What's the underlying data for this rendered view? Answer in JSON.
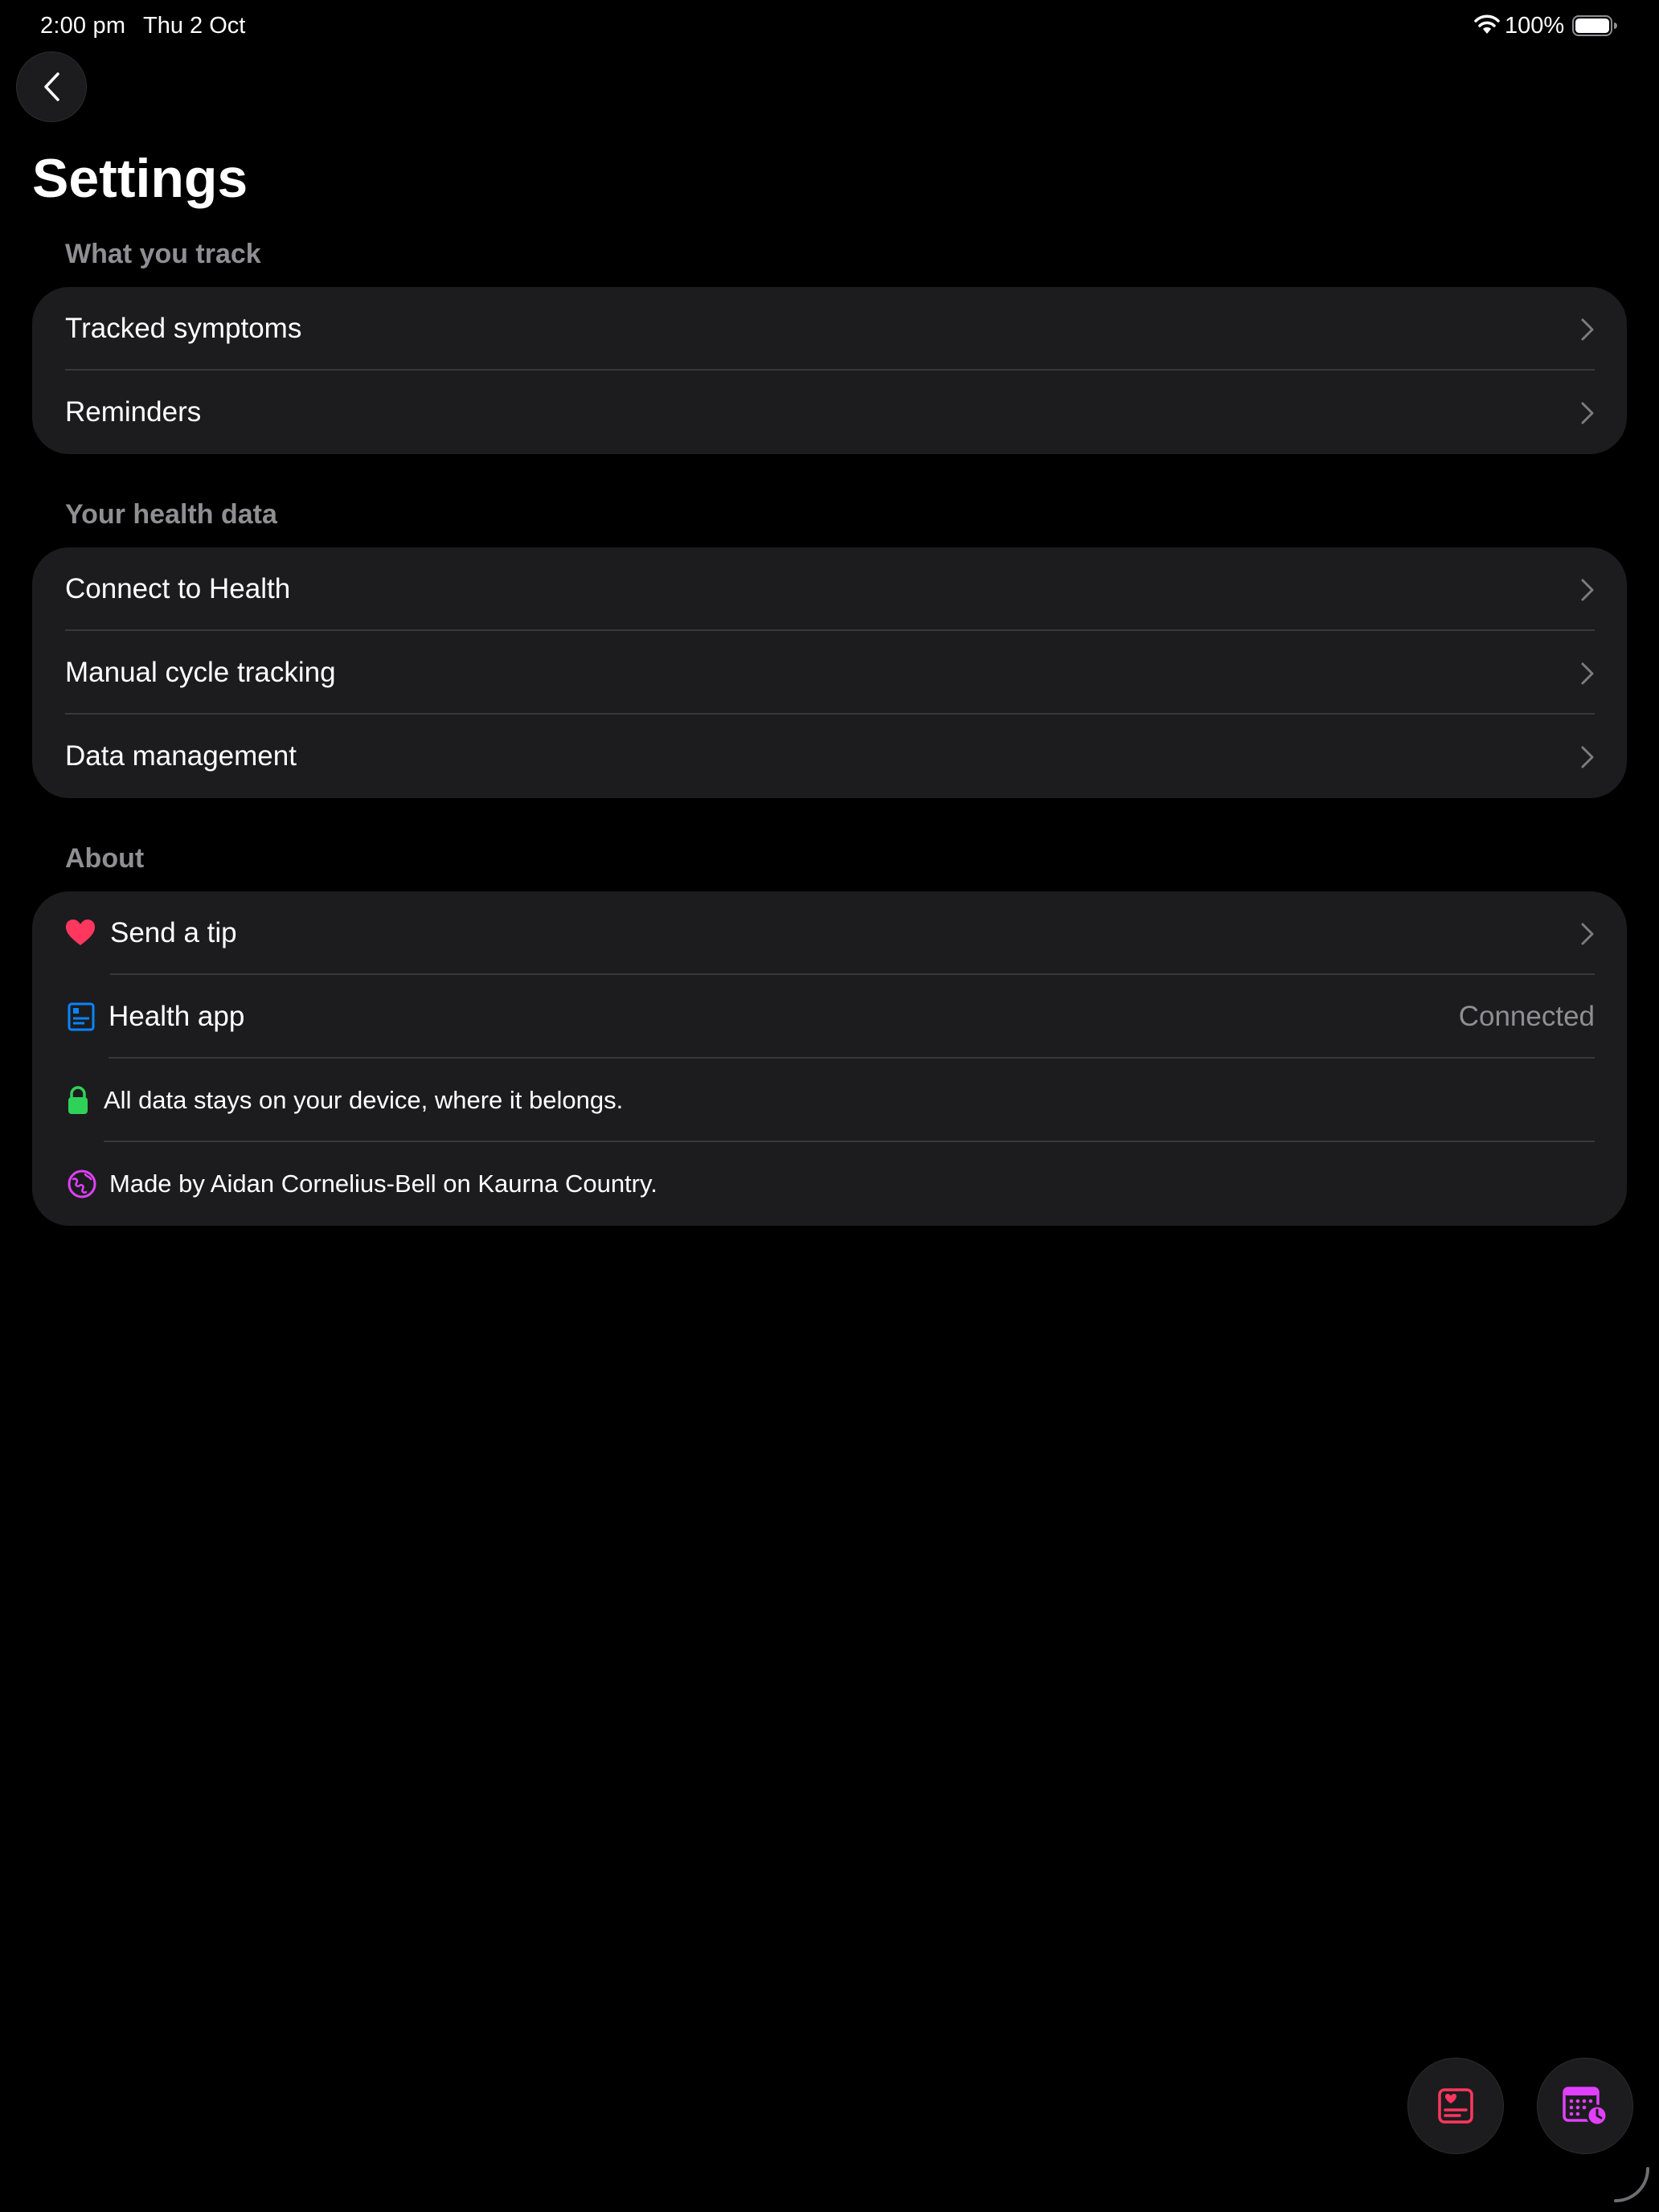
{
  "status_bar": {
    "time": "2:00 pm",
    "date": "Thu 2 Oct",
    "battery_percent": "100%",
    "battery_level": 1.0
  },
  "header": {
    "title": "Settings",
    "back_icon": "chevron-left-icon"
  },
  "sections": {
    "track": {
      "header": "What you track",
      "items": [
        {
          "label": "Tracked symptoms"
        },
        {
          "label": "Reminders"
        }
      ]
    },
    "health": {
      "header": "Your health data",
      "items": [
        {
          "label": "Connect to Health"
        },
        {
          "label": "Manual cycle tracking"
        },
        {
          "label": "Data management"
        }
      ]
    },
    "about": {
      "header": "About",
      "items": [
        {
          "label": "Send a tip",
          "icon": "heart-icon"
        },
        {
          "label": "Health app",
          "value": "Connected",
          "icon": "health-record-icon"
        },
        {
          "label": "All data stays on your device, where it belongs.",
          "icon": "lock-icon"
        },
        {
          "label": "Made by Aidan Cornelius-Bell on Kaurna Country.",
          "icon": "globe-icon"
        }
      ]
    }
  },
  "floating_buttons": {
    "log_icon": "health-log-icon",
    "calendar_icon": "calendar-clock-icon"
  },
  "colors": {
    "background": "#000000",
    "card": "#1c1c1e",
    "secondary_text": "#8e8e93",
    "heart": "#ff375f",
    "health_blue": "#0a84ff",
    "lock_green": "#30d158",
    "accent_magenta": "#e040fb",
    "log_pink": "#ff375f"
  }
}
